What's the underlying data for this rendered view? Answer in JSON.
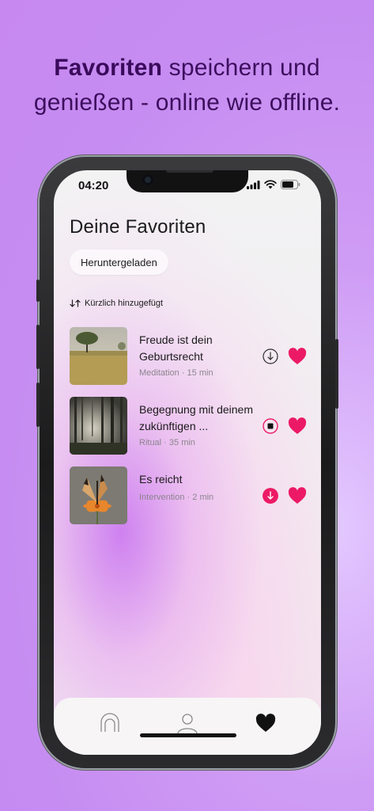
{
  "headline": {
    "bold": "Favoriten",
    "line1_rest": " speichern und",
    "line2": "genießen - online wie offline."
  },
  "status": {
    "time": "04:20"
  },
  "page": {
    "title": "Deine Favoriten"
  },
  "filter": {
    "chip_label": "Heruntergeladen"
  },
  "sort": {
    "label": "Kürzlich hinzugefügt"
  },
  "favorites": [
    {
      "title": "Freude ist dein Geburtsrecht",
      "category": "Meditation",
      "duration": "15 min",
      "download_state": "download",
      "image": "tree-in-field"
    },
    {
      "title": "Begegnung mit deinem zukünftigen ...",
      "category": "Ritual",
      "duration": "35 min",
      "download_state": "downloading",
      "image": "misty-forest"
    },
    {
      "title": "Es reicht",
      "category": "Intervention",
      "duration": "2 min",
      "download_state": "downloaded",
      "image": "butterfly-on-flower"
    }
  ],
  "colors": {
    "accent": "#ec1a66",
    "headline": "#3a0a5c",
    "background": "#c88ef1"
  },
  "tabbar": {
    "items": [
      "home-icon",
      "profile-icon",
      "heart-icon"
    ],
    "active": "heart-icon"
  }
}
